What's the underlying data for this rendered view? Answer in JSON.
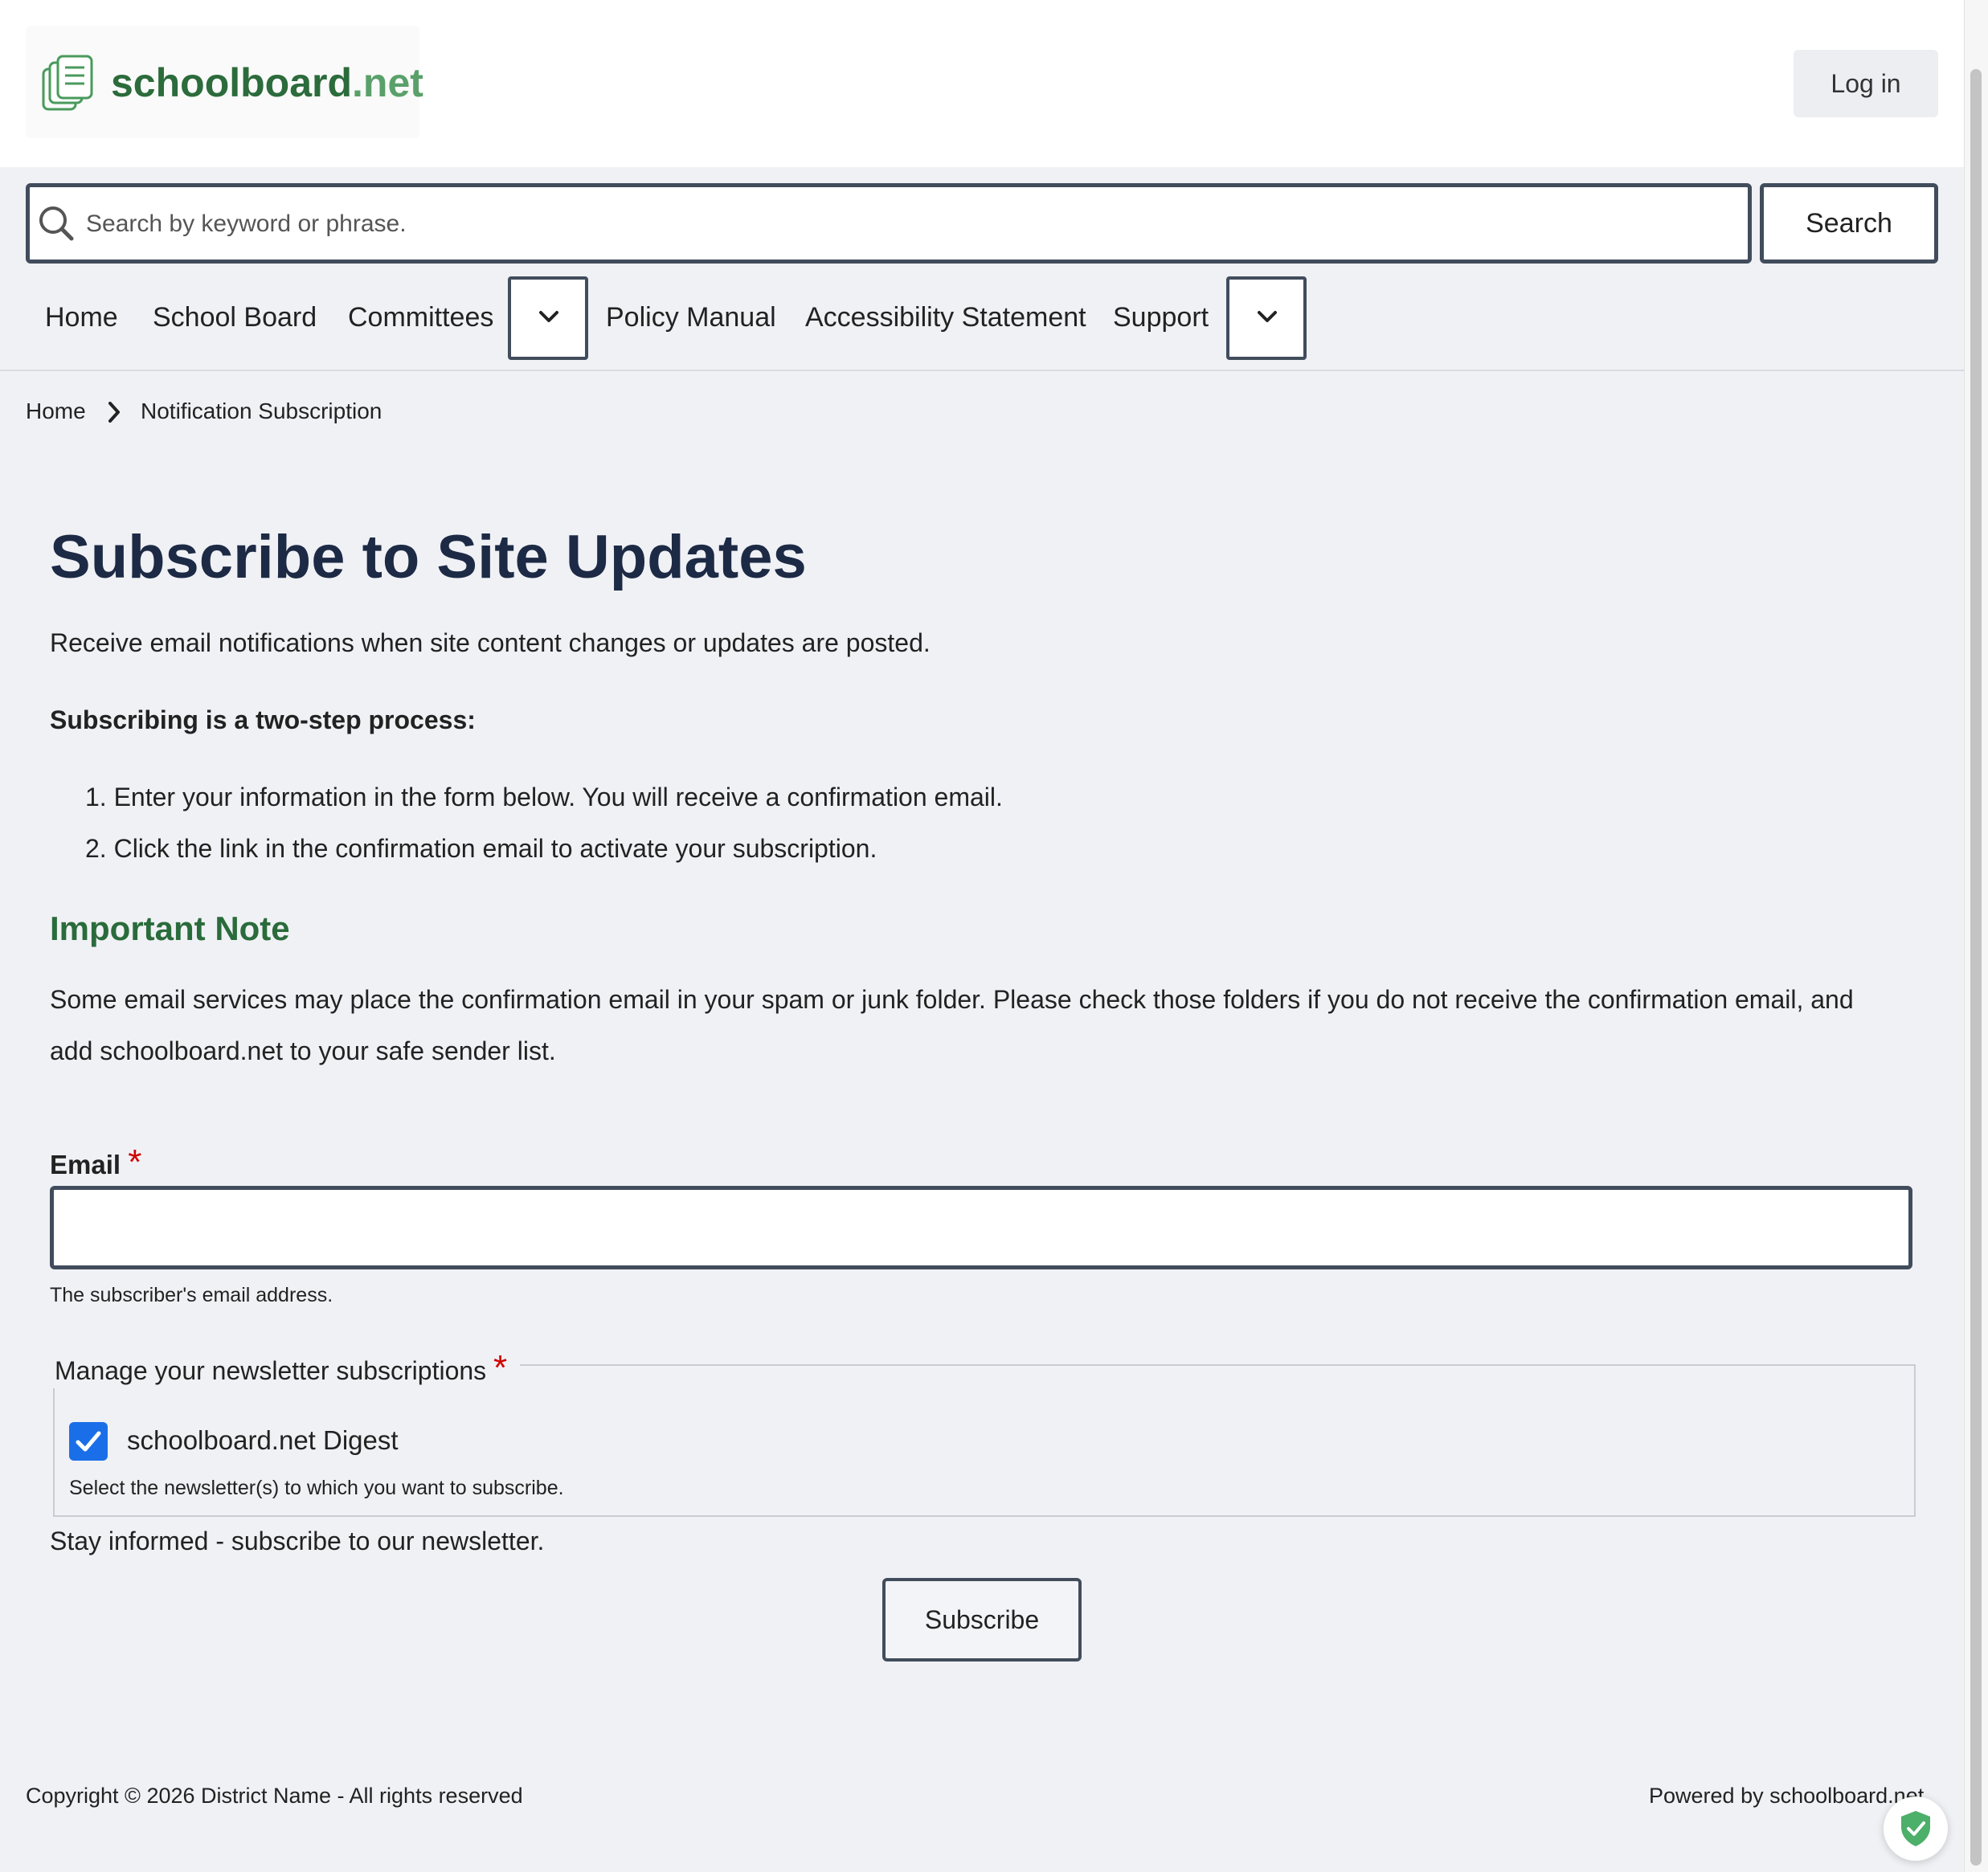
{
  "header": {
    "logo_text": "schoolboard",
    "logo_tld": ".net",
    "login_label": "Log in"
  },
  "search": {
    "placeholder": "Search by keyword or phrase.",
    "button_label": "Search"
  },
  "nav": {
    "items": [
      {
        "label": "Home"
      },
      {
        "label": "School Board"
      },
      {
        "label": "Committees"
      },
      {
        "label": "Policy Manual"
      },
      {
        "label": "Accessibility Statement"
      },
      {
        "label": "Support"
      }
    ]
  },
  "breadcrumb": {
    "items": [
      {
        "label": "Home"
      },
      {
        "label": "Notification Subscription"
      }
    ]
  },
  "main": {
    "title": "Subscribe to Site Updates",
    "intro": "Receive email notifications when site content changes or updates are posted.",
    "process_heading": "Subscribing is a two-step process:",
    "steps": [
      "1. Enter your information in the form below. You will receive a confirmation email.",
      "2. Click the link in the confirmation email to activate your subscription."
    ],
    "note_heading": "Important Note",
    "note_text_line1": "Some email services may place the confirmation email in your spam or junk folder. Please check those folders if you do not receive the confirmation email, and",
    "note_text_line2": "add schoolboard.net to your safe sender list."
  },
  "form": {
    "email_label": "Email",
    "required_mark": "*",
    "email_value": "",
    "email_help": "The subscriber's email address.",
    "newsletter_legend": "Manage your newsletter subscriptions",
    "newsletter_option": "schoolboard.net Digest",
    "newsletter_checked": true,
    "newsletter_help": "Select the newsletter(s) to which you want to subscribe.",
    "stay_informed": "Stay informed - subscribe to our newsletter.",
    "submit_label": "Subscribe"
  },
  "footer": {
    "copyright": "Copyright © 2026 District Name - All rights reserved",
    "powered_by": "Powered by schoolboard.net"
  },
  "colors": {
    "brand_green": "#2c6b3b",
    "title_navy": "#1d2a45",
    "checkbox_blue": "#1a6fe8",
    "required_red": "#d10000"
  }
}
